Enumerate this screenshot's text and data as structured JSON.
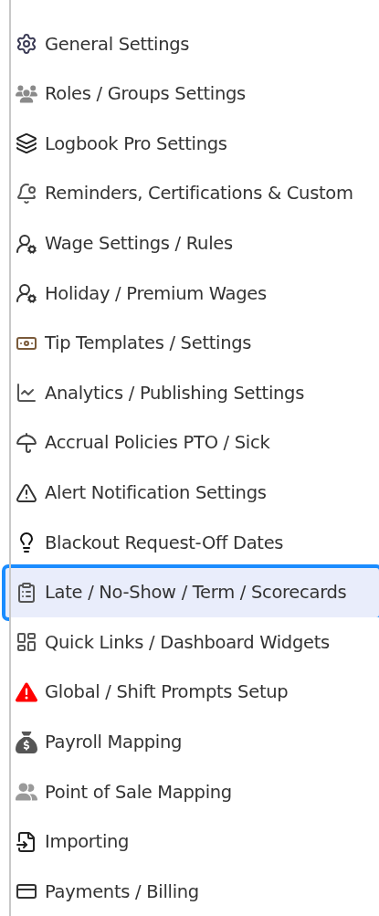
{
  "menu": {
    "items": [
      {
        "label": "General Settings",
        "selected": false
      },
      {
        "label": "Roles / Groups Settings",
        "selected": false
      },
      {
        "label": "Logbook Pro Settings",
        "selected": false
      },
      {
        "label": "Reminders, Certifications & Custom",
        "selected": false
      },
      {
        "label": "Wage Settings / Rules",
        "selected": false
      },
      {
        "label": "Holiday / Premium Wages",
        "selected": false
      },
      {
        "label": "Tip Templates / Settings",
        "selected": false
      },
      {
        "label": "Analytics / Publishing Settings",
        "selected": false
      },
      {
        "label": "Accrual Policies PTO / Sick",
        "selected": false
      },
      {
        "label": "Alert Notification Settings",
        "selected": false
      },
      {
        "label": "Blackout Request-Off Dates",
        "selected": false
      },
      {
        "label": "Late / No-Show / Term / Scorecards",
        "selected": true
      },
      {
        "label": "Quick Links / Dashboard Widgets",
        "selected": false
      },
      {
        "label": "Global / Shift Prompts Setup",
        "selected": false
      },
      {
        "label": "Payroll Mapping",
        "selected": false
      },
      {
        "label": "Point of Sale Mapping",
        "selected": false
      },
      {
        "label": "Importing",
        "selected": false
      },
      {
        "label": "Payments / Billing",
        "selected": false
      }
    ]
  }
}
